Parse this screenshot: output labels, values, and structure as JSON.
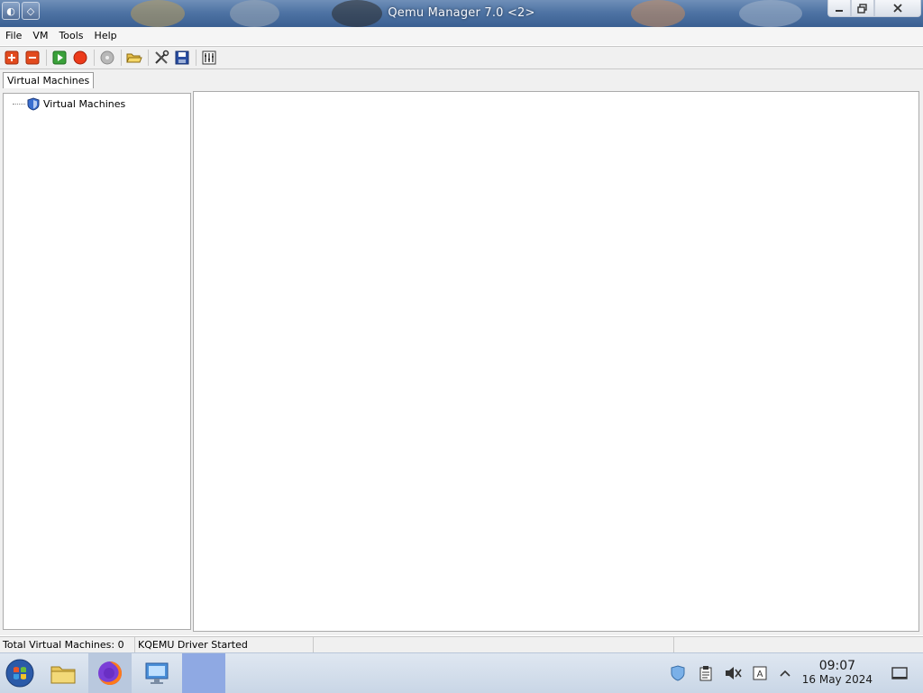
{
  "window": {
    "title": "Qemu Manager 7.0 <2>"
  },
  "menu": [
    "File",
    "VM",
    "Tools",
    "Help"
  ],
  "toolbar": {
    "buttons": [
      {
        "name": "add-vm-button",
        "icon": "add-icon"
      },
      {
        "name": "remove-vm-button",
        "icon": "remove-icon"
      },
      {
        "name": "start-vm-button",
        "icon": "play-icon"
      },
      {
        "name": "stop-vm-button",
        "icon": "stop-icon"
      },
      {
        "name": "disc-button",
        "icon": "disc-icon"
      },
      {
        "name": "open-button",
        "icon": "folder-open-icon"
      },
      {
        "name": "tools-button",
        "icon": "tools-icon"
      },
      {
        "name": "save-button",
        "icon": "save-icon"
      },
      {
        "name": "settings-button",
        "icon": "settings-icon"
      }
    ]
  },
  "tabs": [
    "Virtual Machines"
  ],
  "tree": {
    "root_label": "Virtual Machines"
  },
  "status": {
    "total": "Total Virtual Machines: 0",
    "driver": "KQEMU Driver Started"
  },
  "clock": {
    "time": "09:07",
    "date": "16 May 2024"
  },
  "colors": {
    "titlebar": "#4f74a4",
    "taskbar": "#d3deeb",
    "active_task": "#8fa9e3"
  }
}
